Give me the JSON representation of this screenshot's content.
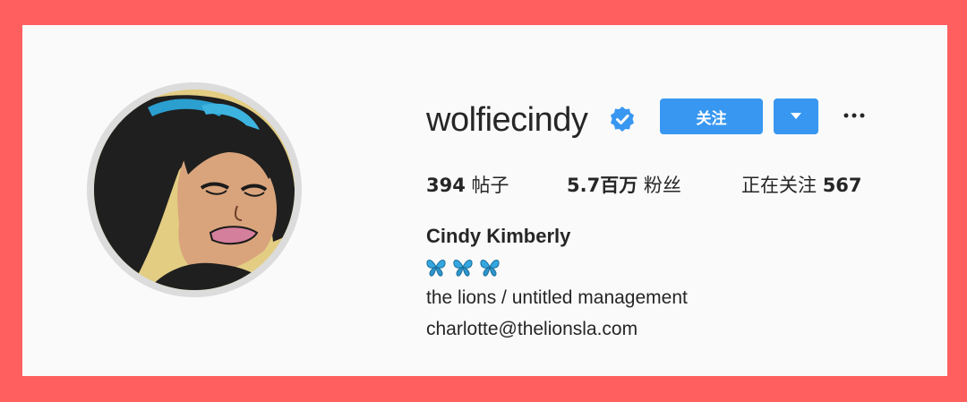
{
  "profile": {
    "username": "wolfiecindy",
    "full_name": "Cindy Kimberly",
    "bio_line1": "the lions / untitled management",
    "bio_line2": "charlotte@thelionsla.com",
    "emoji": [
      "butterfly-icon",
      "butterfly-icon",
      "butterfly-icon"
    ]
  },
  "actions": {
    "follow_label": "关注"
  },
  "stats": {
    "posts_count": "394",
    "posts_label": "帖子",
    "followers_count": "5.7百万",
    "followers_label": "粉丝",
    "following_label": "正在关注",
    "following_count": "567"
  },
  "colors": {
    "frame": "#ff5f5f",
    "accent": "#3897f0",
    "card": "#fbfafa",
    "verified": "#3897f0"
  }
}
